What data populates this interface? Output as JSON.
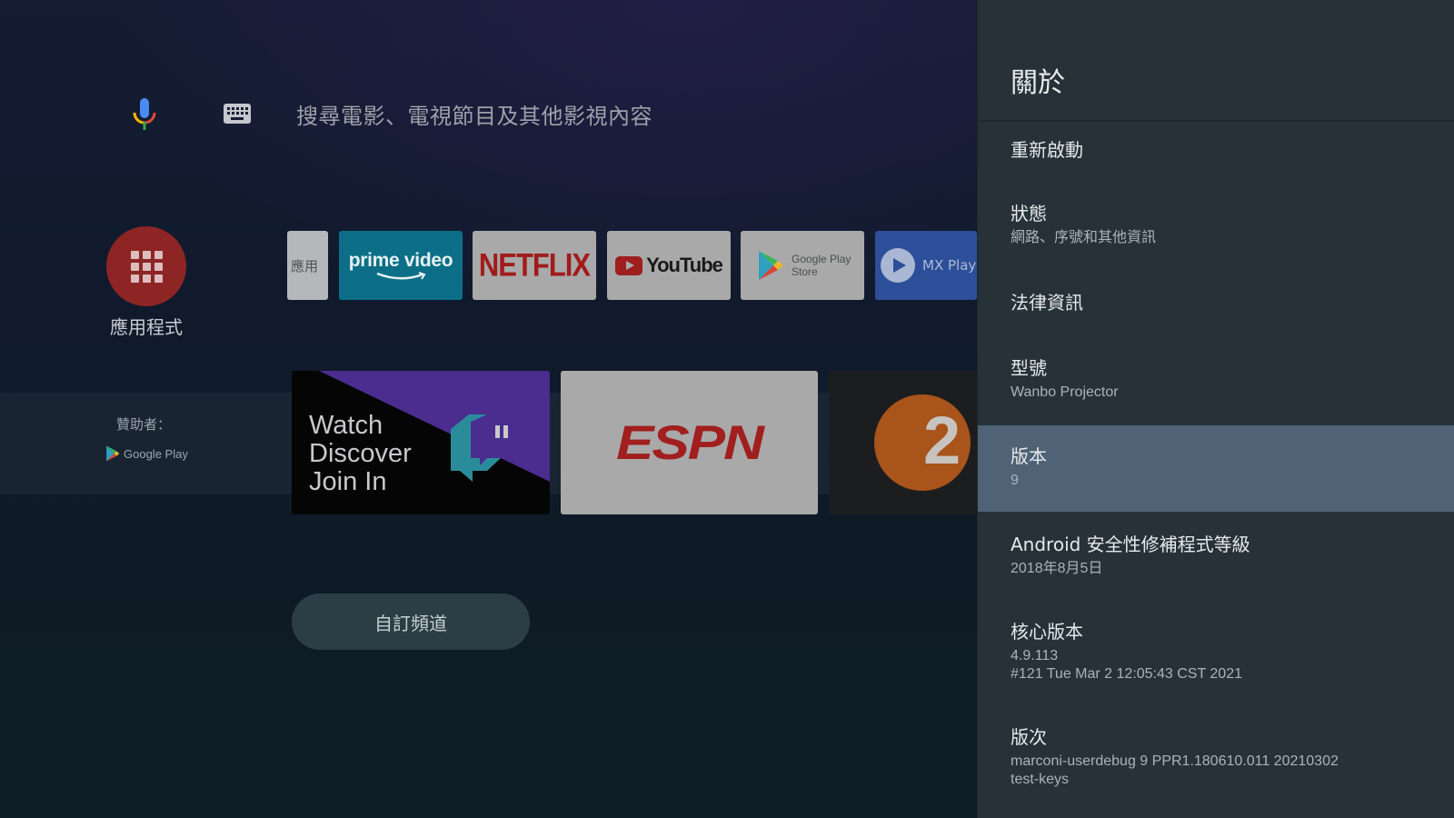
{
  "search": {
    "placeholder": "搜尋電影、電視節目及其他影視內容",
    "icons": [
      "mic-icon",
      "keyboard-icon"
    ]
  },
  "apps_button": {
    "label": "應用程式",
    "color": "#8e2525"
  },
  "app_row": {
    "partial_label": "應用",
    "prime_label": "prime video",
    "netflix_label": "NETFLIX",
    "youtube_label": "YouTube",
    "play_label_1": "Google Play",
    "play_label_2": "Store",
    "mx_label": "MX Playe"
  },
  "sponsored": {
    "label": "贊助者：",
    "source": "Google Play"
  },
  "cards": {
    "twitch_text": [
      "Watch",
      "Discover",
      "Join In"
    ],
    "espn": "ESPN",
    "third_number": "2"
  },
  "custom_channels": {
    "label": "自訂頻道"
  },
  "settings_panel": {
    "title": "關於",
    "items": [
      {
        "title": "重新啟動"
      },
      {
        "title": "狀態",
        "subtitle": "網路、序號和其他資訊"
      },
      {
        "title": "法律資訊"
      },
      {
        "title": "型號",
        "subtitle": "Wanbo Projector"
      },
      {
        "title": "版本",
        "subtitle": "9",
        "selected": true
      },
      {
        "title": "Android 安全性修補程式等級",
        "subtitle": "2018年8月5日"
      },
      {
        "title": "核心版本",
        "subtitle": "4.9.113",
        "subtitle2": "#121 Tue Mar 2 12:05:43 CST 2021"
      },
      {
        "title": "版次",
        "subtitle": "marconi-userdebug 9 PPR1.180610.011 20210302",
        "subtitle2": "test-keys"
      }
    ],
    "selected_color": "#4f6276"
  }
}
